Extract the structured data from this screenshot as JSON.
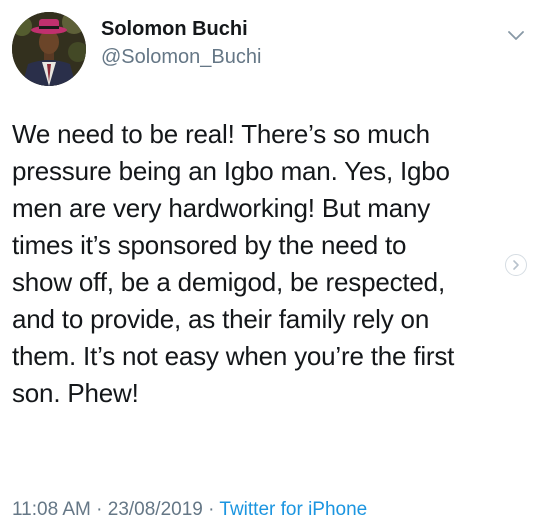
{
  "author": {
    "display_name": "Solomon Buchi",
    "handle": "@Solomon_Buchi"
  },
  "tweet": {
    "lines": [
      "We need to be real! There’s so much",
      "pressure being an Igbo man. Yes, Igbo",
      "men are very hardworking! But many",
      "times it’s sponsored by the need to",
      "show off, be a demigod, be respected,",
      "and to provide, as their family rely on",
      "them. It’s not easy when you’re the first",
      "son. Phew!"
    ],
    "time": "11:08 AM",
    "date": "23/08/2019",
    "separator": "·",
    "source": "Twitter for iPhone"
  },
  "icons": {
    "menu": "chevron-down-icon",
    "next": "chevron-right-icon"
  },
  "colors": {
    "text": "#14171a",
    "muted": "#657786",
    "link": "#1b95e0"
  }
}
